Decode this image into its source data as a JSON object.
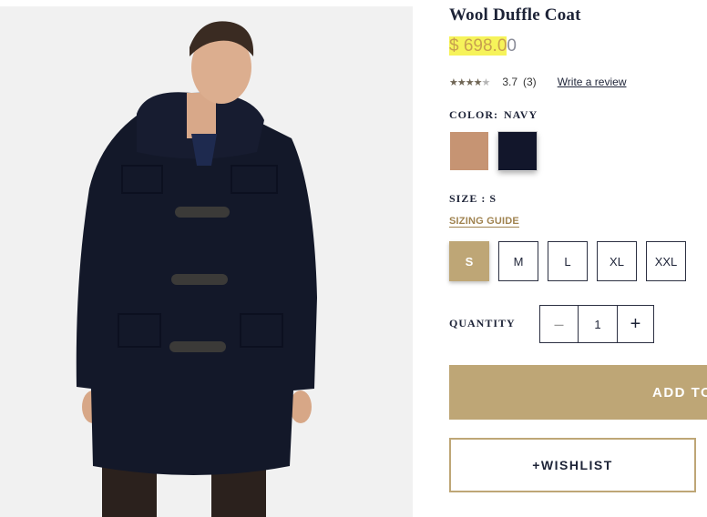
{
  "product": {
    "title": "Wool Duffle Coat",
    "price_highlighted": "$ 698.0",
    "price_rest": "0",
    "rating": {
      "stars_filled": "★★★★",
      "stars_empty": "★",
      "score": "3.7",
      "count": "(3)",
      "write_review": "Write a review"
    }
  },
  "color": {
    "label": "COLOR:",
    "selected": "NAVY",
    "swatches": [
      "#c69473",
      "#12162b"
    ]
  },
  "size": {
    "label": "SIZE : S",
    "guide": "SIZING GUIDE",
    "options": [
      "S",
      "M",
      "L",
      "XL",
      "XXL"
    ],
    "selected": "S"
  },
  "quantity": {
    "label": "QUANTITY",
    "minus": "–",
    "value": "1",
    "plus": "+"
  },
  "actions": {
    "add_to_bag": "ADD TO BAG",
    "wishlist": "+WISHLIST"
  },
  "colors": {
    "accent": "#bea676",
    "navy": "#1d2337",
    "highlight": "#f6f35a"
  }
}
